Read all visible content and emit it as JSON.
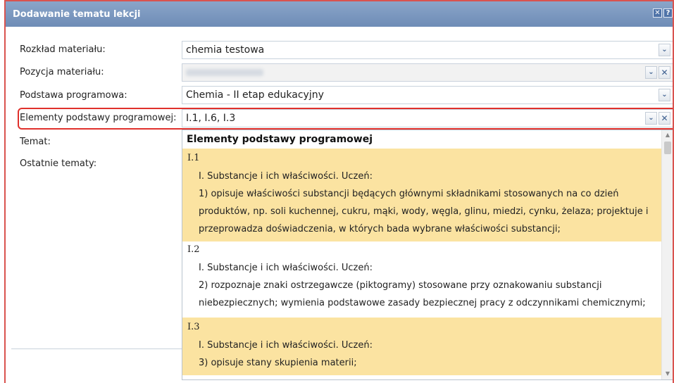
{
  "dialog": {
    "title": "Dodawanie tematu lekcji",
    "close_glyph": "✕",
    "help_glyph": "?"
  },
  "form": {
    "rozklad": {
      "label": "Rozkład materiału:",
      "value": "chemia testowa"
    },
    "pozycja": {
      "label": "Pozycja materiału:"
    },
    "podstawa": {
      "label": "Podstawa programowa:",
      "value": "Chemia - II etap edukacyjny"
    },
    "elementy": {
      "label": "Elementy podstawy programowej:",
      "value": "I.1, I.6, I.3"
    },
    "temat": {
      "label": "Temat:"
    },
    "ostatnie": {
      "label": "Ostatnie tematy:"
    }
  },
  "icons": {
    "dropdown": "chevron-down-icon",
    "clear": "close-icon"
  },
  "glyphs": {
    "chevron": "⌄",
    "clear": "✕",
    "up": "▲",
    "down": "▼"
  },
  "dropdown": {
    "header": "Elementy podstawy programowej",
    "items": [
      {
        "code": "I.1",
        "selected": true,
        "lines": [
          "I. Substancje i ich właściwości. Uczeń:",
          "1) opisuje właściwości substancji będących głównymi składnikami stosowanych na co dzień",
          "produktów, np. soli kuchennej, cukru, mąki, wody, węgla, glinu, miedzi, cynku, żelaza; projektuje i",
          "przeprowadza doświadczenia, w których bada wybrane właściwości substancji;"
        ]
      },
      {
        "code": "I.2",
        "selected": false,
        "lines": [
          "I. Substancje i ich właściwości. Uczeń:",
          "2) rozpoznaje znaki ostrzegawcze (piktogramy) stosowane przy oznakowaniu substancji",
          "niebezpiecznych; wymienia podstawowe zasady bezpiecznej pracy z odczynnikami chemicznymi;"
        ]
      },
      {
        "code": "I.3",
        "selected": true,
        "lines": [
          "I. Substancje i ich właściwości. Uczeń:",
          "3) opisuje stany skupienia materii;"
        ]
      }
    ]
  },
  "colors": {
    "titlebar": "#7593bd",
    "selected_row": "#fbe3a1",
    "highlight_frame": "#e0312c"
  }
}
